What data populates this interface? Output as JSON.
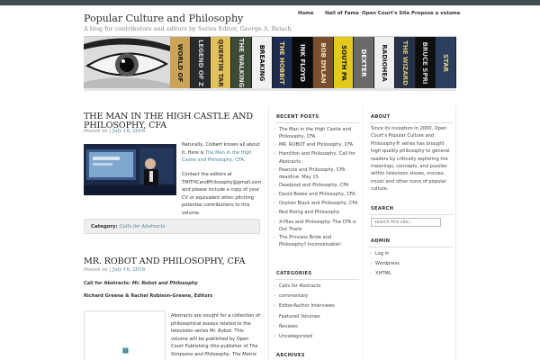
{
  "site": {
    "title": "Popular Culture and Philosophy",
    "description": "A blog for contributors and editors by Series Editor, George A. Reisch"
  },
  "nav": [
    {
      "label": "Home"
    },
    {
      "label": "Hall of Fame"
    },
    {
      "label": "Open Court's Site"
    },
    {
      "label": "Propose a volume"
    }
  ],
  "banner": {
    "spines": [
      {
        "text": "WORLD OF",
        "bg": "#caa458",
        "fg": "#1a1a1a"
      },
      {
        "text": "LEGEND OF Z",
        "bg": "#272a2e",
        "fg": "#cfcfcf"
      },
      {
        "text": "QUENTIN TAR",
        "bg": "#e0c15a",
        "fg": "#2a2a2a"
      },
      {
        "text": "THE WALKING",
        "bg": "#3c4b35",
        "fg": "#e0e0e0"
      },
      {
        "text": "BREAKING",
        "bg": "#f1f1f1",
        "fg": "#111"
      },
      {
        "text": "THE HOBBIT",
        "bg": "#1f2c52",
        "fg": "#e8d37a"
      },
      {
        "text": "INK FLOYD",
        "bg": "#0a0a0a",
        "fg": "#f0f0f0"
      },
      {
        "text": "BOB DYLAN",
        "bg": "#7a4f2d",
        "fg": "#f0e0c0"
      },
      {
        "text": "SOUTH PA",
        "bg": "#e3c91c",
        "fg": "#1a1a1a"
      },
      {
        "text": "DEXTER",
        "bg": "#6a6a6a",
        "fg": "#fff"
      },
      {
        "text": "RADIOHEA",
        "bg": "#efefef",
        "fg": "#222"
      },
      {
        "text": "THE WIZARD",
        "bg": "#25324a",
        "fg": "#d9c06b"
      },
      {
        "text": "BRUCE SPRI",
        "bg": "#0e0e0e",
        "fg": "#d0d0d0"
      },
      {
        "text": "STAR",
        "bg": "#2b3e60",
        "fg": "#e6d27a"
      }
    ]
  },
  "posts": [
    {
      "title": "The Man in the High Castle and Philosophy, CFA",
      "meta_prefix": "Posted on",
      "date": "July 18, 2016",
      "text_1": "Naturally, Colbert knows all about it. Here is ",
      "link_text": "The Man in the High Castle and Philosophy, CFA",
      "text_2": ".",
      "text_3": "Contact the editors at TMITHCandPhilosophy@gmail.com and please include a copy of your CV or equivalent when pitching potential contributions to this volume.",
      "category_label": "Category:",
      "category_link": "Calls for Abstracts"
    },
    {
      "title": "Mr. Robot and Philosophy, CFA",
      "meta_prefix": "Posted on",
      "date": "July 16, 2016",
      "call_label": "Call for Abstracts:",
      "call_title": "Mr. Robot and Philosophy",
      "editors": "Richard Greene & Rachel Robison-Greene, Editors",
      "body_1": "Abstracts are sought for a collection of philosophical essays related to the television series ",
      "body_show": "Mr. Robot",
      "body_2": ". This volume will be published by Open Court Publishing (the publisher of ",
      "body_ref_1": "The Simpsons and Philosophy",
      "body_3": ", ",
      "body_ref_2": "The Matrix"
    }
  ],
  "sidebar": {
    "recent_title": "Recent Posts",
    "recent": [
      "The Man in the High Castle and Philosophy, CFA",
      "MR. ROBOT and Philosophy, CFA",
      "Hamilton and Philosophy, Call for Abstracts",
      "Peanuts and Philosophy, CFA deadline: May 15",
      "Deadpool and Philosophy, CFA",
      "David Bowie and Philosophy, CFA",
      "Orphan Black and Philosophy, CFA",
      "Red Rising and Philosophy",
      "X-Files and Philosophy: The CFA is Out There",
      "The Princess Bride and Philosophy? Inconceivable!"
    ],
    "categories_title": "Categories",
    "categories": [
      "Calls for Abstracts",
      "commentary",
      "Editor/Author Interviews",
      "Featured Volumes",
      "Reviews",
      "Uncategorized"
    ],
    "archives_title": "Archives",
    "about_title": "About",
    "about_text": "Since its inception in 2000, Open Court's Popular Culture and Philosophy® series has brought high-quality philosophy to general readers by critically exploring the meanings, concepts, and puzzles within television shows, movies, music and other icons of popular culture.",
    "search_title": "Search",
    "search_placeholder": "search this site...",
    "admin_title": "Admin",
    "admin": [
      "Log in",
      "Wordpress",
      "XHTML"
    ]
  }
}
